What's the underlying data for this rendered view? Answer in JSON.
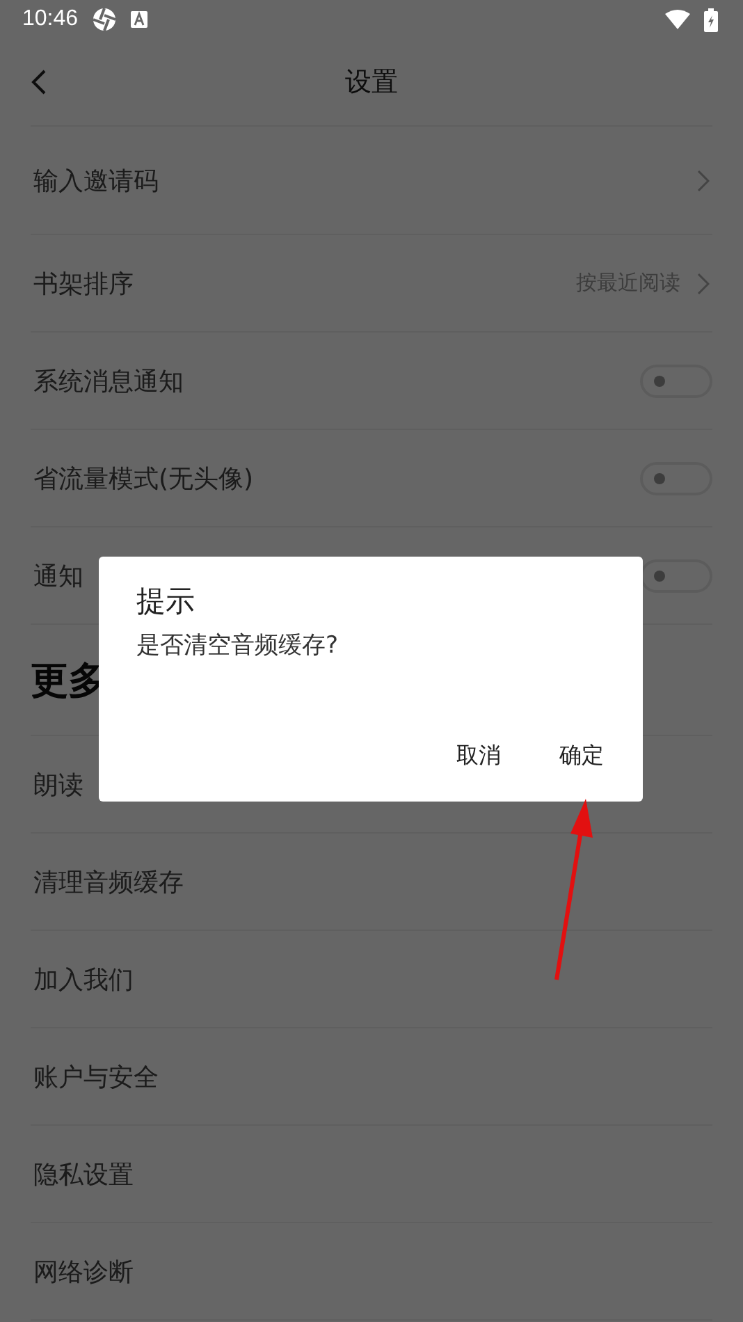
{
  "status_bar": {
    "time": "10:46"
  },
  "header": {
    "title": "设置"
  },
  "rows": [
    {
      "kind": "link",
      "label": "输入邀请码"
    },
    {
      "kind": "link",
      "label": "书架排序",
      "value": "按最近阅读"
    },
    {
      "kind": "toggle",
      "label": "系统消息通知",
      "on": false
    },
    {
      "kind": "toggle",
      "label": "省流量模式(无头像)",
      "on": false
    },
    {
      "kind": "toggle",
      "label": "通知",
      "on": false
    },
    {
      "kind": "section",
      "label": "更多"
    },
    {
      "kind": "plain",
      "label": "朗读"
    },
    {
      "kind": "plain",
      "label": "清理音频缓存"
    },
    {
      "kind": "plain",
      "label": "加入我们"
    },
    {
      "kind": "plain",
      "label": "账户与安全"
    },
    {
      "kind": "plain",
      "label": "隐私设置"
    },
    {
      "kind": "plain",
      "label": "网络诊断"
    }
  ],
  "dialog": {
    "title": "提示",
    "message": "是否清空音频缓存?",
    "buttons": [
      "取消",
      "确定"
    ]
  }
}
